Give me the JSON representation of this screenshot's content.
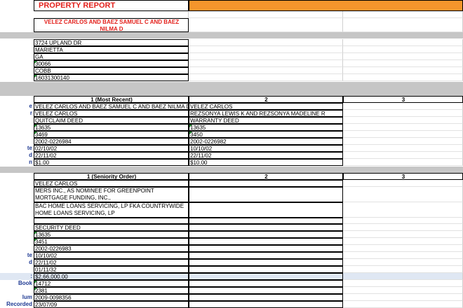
{
  "report": {
    "title": "PROPERTY REPORT",
    "owner_names": "VELEZ CARLOS AND BAEZ SAMUEL C AND BAEZ NILMA D"
  },
  "property": {
    "address": "3724 UPLAND DR",
    "city": "MARIETTA",
    "state": "GA",
    "zip": "30066",
    "county": "COBB",
    "parcel": "16031300140"
  },
  "deeds": {
    "labels": [
      "e",
      "r",
      "",
      "",
      "",
      "",
      "te",
      "d",
      "n"
    ],
    "headers": [
      "1 (Most Recent)",
      "2",
      "3"
    ],
    "col1": [
      "VELEZ CARLOS AND BAEZ SAMUEL C AND BAEZ NILMA D",
      "VELEZ CARLOS",
      "QUITCLAIM DEED",
      "13635",
      "3469",
      "2002-0226984",
      "02/10/02",
      "22/11/02",
      "$1.00"
    ],
    "col2": [
      "VELEZ CARLOS",
      "REZSONYA LEWIS K AND REZSONYA MADELINE R",
      "WARRANTY DEED",
      "13635",
      "3450",
      "2002-0226982",
      "10/10/02",
      "22/11/02",
      "$10.00"
    ]
  },
  "mortgages": {
    "headers": [
      "1 (Seniority Order)",
      "2",
      "3"
    ],
    "labels": [
      "",
      "",
      "",
      "",
      "",
      "",
      "",
      "",
      "te",
      "d",
      "",
      "",
      "Book",
      "",
      "lum",
      "Recorded"
    ],
    "col1": {
      "borrower": "VELEZ CARLOS",
      "lender": "MERS INC., AS NOMINEE FOR GREENPOINT MORTGAGE FUNDING, INC.,",
      "assignee": "BAC HOME LOANS SERVICING, LP FKA COUNTRYWIDE HOME LOANS SERVICING, LP",
      "blank": "",
      "deed_type": "SECURITY DEED",
      "book": "13635",
      "page": "3451",
      "instrument": "2002-0226983",
      "date": "10/10/02",
      "recorded": "22/11/02",
      "maturity": "01/11/32",
      "amount": "$2,66,000.00",
      "assign_book": "14712",
      "assign_page": "2381",
      "assign_instrument": "2009-0098356",
      "assign_recorded": "23/07/09"
    }
  }
}
